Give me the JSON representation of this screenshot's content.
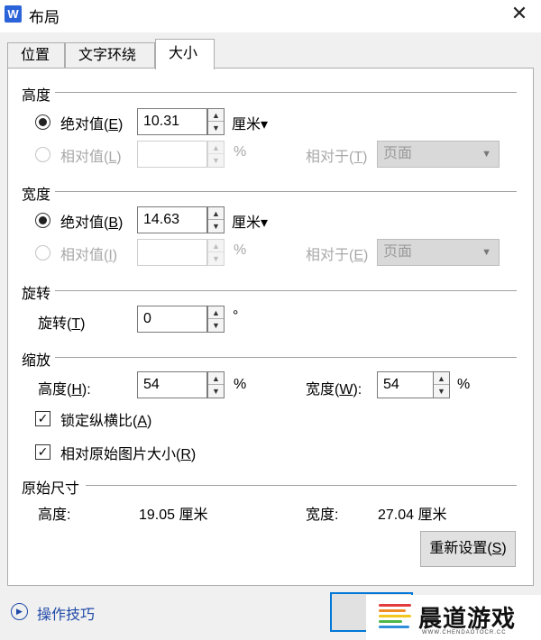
{
  "window": {
    "app_icon_letter": "W",
    "title": "布局",
    "close": "✕"
  },
  "tabs": [
    {
      "label": "位置"
    },
    {
      "label": "文字环绕"
    },
    {
      "label": "大小"
    }
  ],
  "height_section": {
    "title": "高度",
    "absolute": {
      "label": "绝对值(",
      "key": "E",
      "close": ")",
      "value": "10.31",
      "unit": "厘米▾",
      "selected": true
    },
    "relative": {
      "label": "相对值(",
      "key": "L",
      "close": ")",
      "value": "",
      "unit": "%",
      "rel_label": "相对于(",
      "rel_key": "T",
      "rel_close": ")",
      "rel_value": "页面"
    }
  },
  "width_section": {
    "title": "宽度",
    "absolute": {
      "label": "绝对值(",
      "key": "B",
      "close": ")",
      "value": "14.63",
      "unit": "厘米▾",
      "selected": true
    },
    "relative": {
      "label": "相对值(",
      "key": "I",
      "close": ")",
      "value": "",
      "unit": "%",
      "rel_label": "相对于(",
      "rel_key": "E",
      "rel_close": ")",
      "rel_value": "页面"
    }
  },
  "rotate_section": {
    "title": "旋转",
    "label": "旋转(",
    "key": "T",
    "close": ")",
    "value": "0",
    "unit": "°"
  },
  "scale_section": {
    "title": "缩放",
    "height": {
      "label": "高度(",
      "key": "H",
      "close": "):",
      "value": "54",
      "unit": "%"
    },
    "width": {
      "label": "宽度(",
      "key": "W",
      "close": "):",
      "value": "54",
      "unit": "%"
    },
    "lock_aspect": {
      "label": "锁定纵横比(",
      "key": "A",
      "close": ")",
      "checked": true
    },
    "relative_original": {
      "label": "相对原始图片大小(",
      "key": "R",
      "close": ")",
      "checked": true
    }
  },
  "original_section": {
    "title": "原始尺寸",
    "height_label": "高度:",
    "height_value": "19.05 厘米",
    "width_label": "宽度:",
    "width_value": "27.04 厘米",
    "reset_label": "重新设置(",
    "reset_key": "S",
    "reset_close": ")"
  },
  "footer": {
    "help_label": "操作技巧"
  },
  "overlay": {
    "brand": "晨道游戏",
    "sub": "WWW.CHENDAOTOCR.CC"
  }
}
